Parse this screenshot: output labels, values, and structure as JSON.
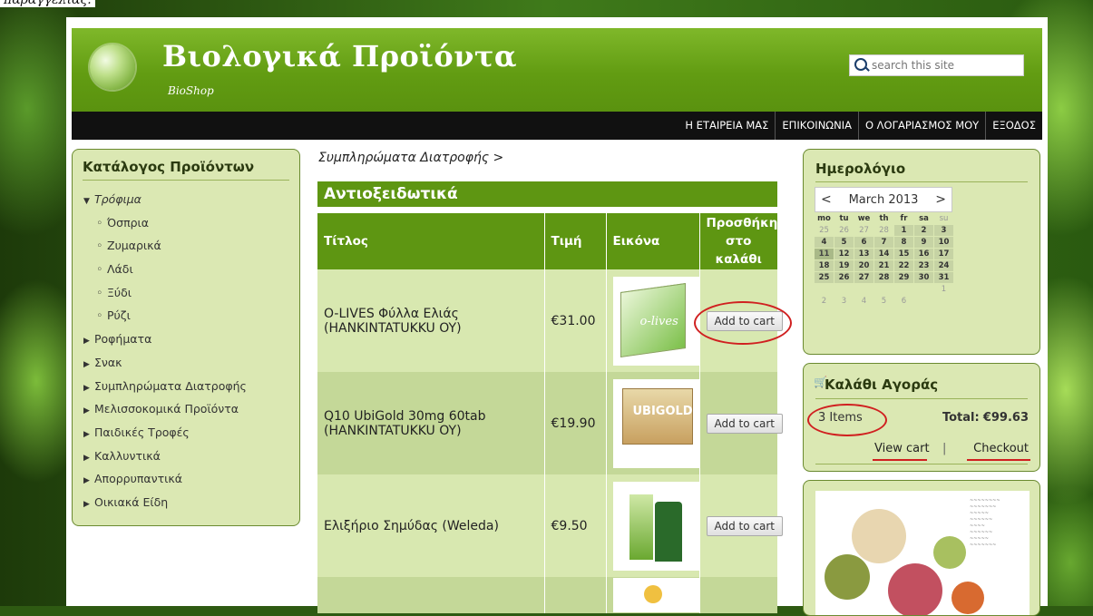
{
  "caption": "παραγγελίας.",
  "header": {
    "title": "Βιολογικά Προϊόντα",
    "subtitle": "BioShop",
    "search_placeholder": "search this site"
  },
  "nav": [
    "Η ΕΤΑΙΡΕΙΑ ΜΑΣ",
    "ΕΠΙΚΟΙΝΩΝΙΑ",
    "Ο ΛΟΓΑΡΙΑΣΜΟΣ ΜΟΥ",
    "ΕΞΟΔΟΣ"
  ],
  "catalog": {
    "title": "Κατάλογος Προϊόντων",
    "items": [
      {
        "label": "Τρόφιμα",
        "expanded": true,
        "children": [
          "Όσπρια",
          "Ζυμαρικά",
          "Λάδι",
          "Ξύδι",
          "Ρύζι"
        ]
      },
      {
        "label": "Ροφήματα"
      },
      {
        "label": "Σνακ"
      },
      {
        "label": "Συμπληρώματα Διατροφής"
      },
      {
        "label": "Μελισσοκομικά Προϊόντα"
      },
      {
        "label": "Παιδικές Τροφές"
      },
      {
        "label": "Καλλυντικά"
      },
      {
        "label": "Απορρυπαντικά"
      },
      {
        "label": "Οικιακά Είδη"
      }
    ]
  },
  "breadcrumb": "Συμπληρώματα Διατροφής >",
  "category_title": "Αντιοξειδωτικά",
  "table": {
    "headers": [
      "Τίτλος",
      "Τιμή",
      "Εικόνα",
      "Προσθήκη στο καλάθι"
    ],
    "rows": [
      {
        "title": "O-LIVES Φύλλα Ελιάς (HANKINTATUKKU OY)",
        "price": "€31.00",
        "image_label": "o-lives",
        "button": "Add to cart"
      },
      {
        "title": "Q10 UbiGold 30mg 60tab (HANKINTATUKKU OY)",
        "price": "€19.90",
        "image_label": "UBIGOLD",
        "button": "Add to cart"
      },
      {
        "title": "Ελιξήριο Σημύδας (Weleda)",
        "price": "€9.50",
        "image_label": "",
        "button": "Add to cart"
      },
      {
        "title": "",
        "price": "",
        "image_label": "",
        "button": ""
      }
    ]
  },
  "calendar": {
    "title": "Ημερολόγιο",
    "month": "March 2013",
    "prev": "<",
    "next": ">",
    "days": [
      "mo",
      "tu",
      "we",
      "th",
      "fr",
      "sa",
      "su"
    ],
    "weeks": [
      [
        "25",
        "26",
        "27",
        "28",
        "1",
        "2",
        "3"
      ],
      [
        "4",
        "5",
        "6",
        "7",
        "8",
        "9",
        "10"
      ],
      [
        "11",
        "12",
        "13",
        "14",
        "15",
        "16",
        "17"
      ],
      [
        "18",
        "19",
        "20",
        "21",
        "22",
        "23",
        "24"
      ],
      [
        "25",
        "26",
        "27",
        "28",
        "29",
        "30",
        "31"
      ],
      [
        "",
        "",
        "",
        "",
        "",
        "",
        "1"
      ],
      [
        "2",
        "3",
        "4",
        "5",
        "6",
        "",
        ""
      ]
    ],
    "su_top": "24"
  },
  "cart": {
    "title": "Καλάθι Αγοράς",
    "items": "3 Items",
    "total_label": "Total:",
    "total_value": "€99.63",
    "view_cart": "View cart",
    "separator": "|",
    "checkout": "Checkout"
  },
  "colors": {
    "header_green": "#629c12",
    "panel_bg": "#dbe8b3",
    "annotation_red": "#d02020"
  }
}
